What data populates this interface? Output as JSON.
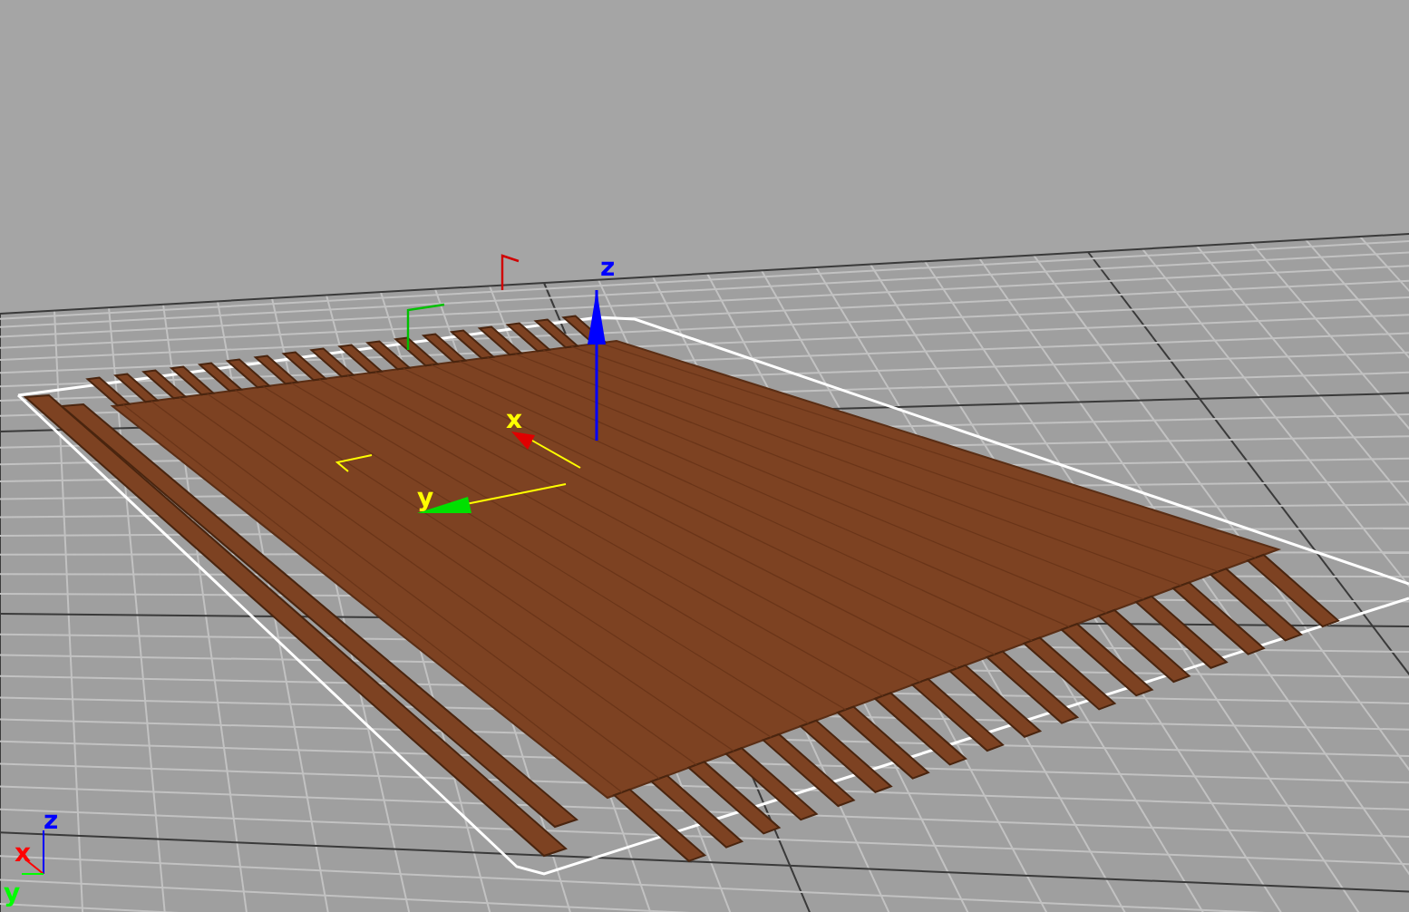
{
  "viewport": {
    "gizmo_labels": [
      {
        "text": "z",
        "color": "#0000ff"
      },
      {
        "text": "x",
        "color": "#ffff00"
      },
      {
        "text": "y",
        "color": "#ffff00"
      }
    ],
    "axis_tripod_labels": [
      {
        "text": "z",
        "color": "#0000ff"
      },
      {
        "text": "x",
        "color": "#ff0000"
      },
      {
        "text": "y",
        "color": "#00ff00"
      }
    ]
  }
}
